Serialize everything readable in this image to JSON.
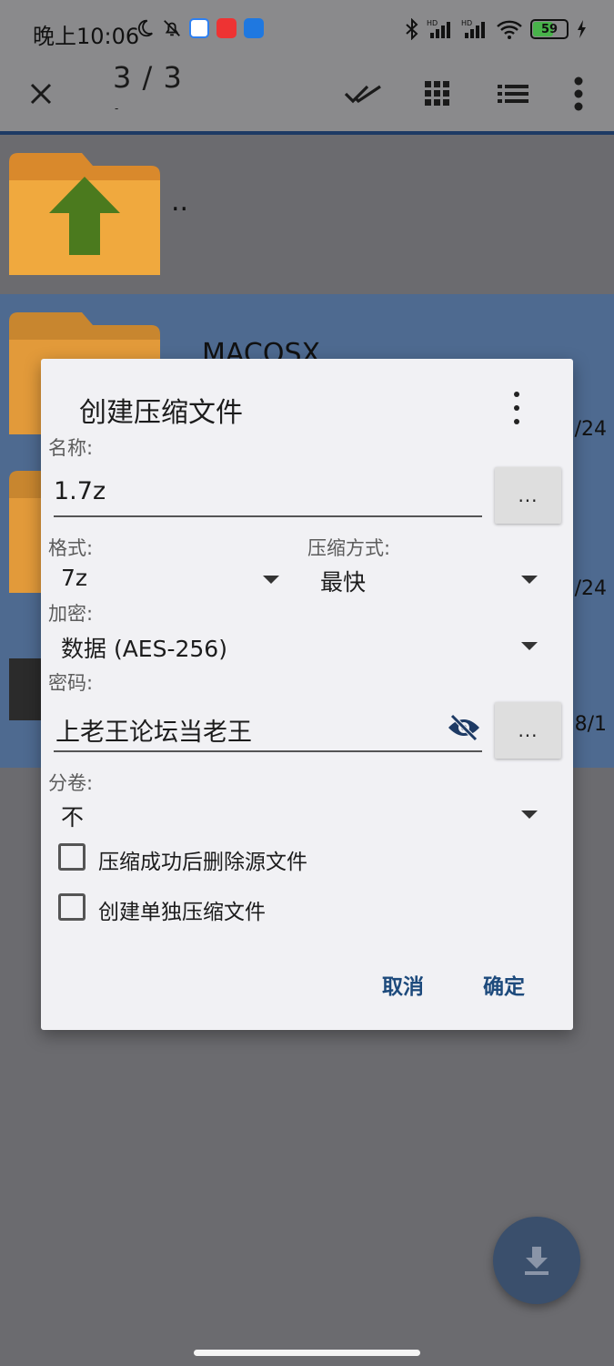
{
  "status_bar": {
    "time": "晚上10:06",
    "battery": "59",
    "left_icons": [
      "moon-icon",
      "bell-off-icon",
      "app-icon-blue",
      "app-icon-red",
      "app-icon-bird"
    ],
    "right_icons": [
      "bluetooth-icon",
      "signal-hd-icon",
      "signal-hd-icon",
      "wifi-icon",
      "battery-icon",
      "charging-icon"
    ]
  },
  "toolbar": {
    "count": "3 / 3",
    "sub": "-",
    "icons": [
      "close-icon",
      "select-all-icon",
      "grid-view-icon",
      "list-view-icon",
      "more-vert-icon"
    ]
  },
  "file_list": {
    "parent_label": "..",
    "items": [
      {
        "name": "MACOSX",
        "meta": "/24"
      },
      {
        "name": "",
        "meta": "/24"
      },
      {
        "name": "",
        "meta": "8/1"
      }
    ]
  },
  "dialog": {
    "title": "创建压缩文件",
    "name_label": "名称:",
    "name_value": "1.7z",
    "browse_label": "...",
    "format_label": "格式:",
    "format_value": "7z",
    "method_label": "压缩方式:",
    "method_value": "最快",
    "encrypt_label": "加密:",
    "encrypt_value": "数据 (AES-256)",
    "password_label": "密码:",
    "password_value": "上老王论坛当老王",
    "split_label": "分卷:",
    "split_value": "不",
    "opt_delete_source": "压缩成功后删除源文件",
    "opt_separate": "创建单独压缩文件",
    "cancel": "取消",
    "ok": "确定"
  },
  "colors": {
    "accent": "#1d4a7c",
    "selected_row": "#4e6a90",
    "fab": "#3a4f6c",
    "folder": "#f2a33a",
    "arrow": "#3e7d1a"
  }
}
